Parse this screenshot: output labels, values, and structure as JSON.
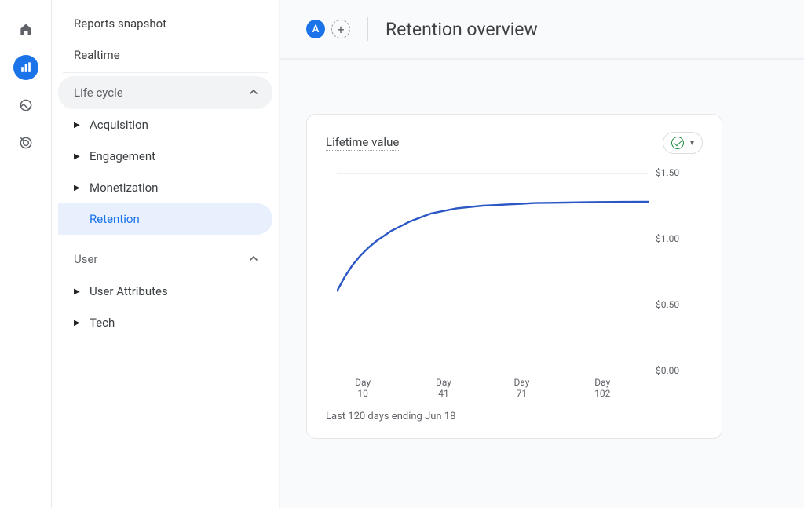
{
  "rail": {
    "items": [
      {
        "name": "home-icon",
        "active": false
      },
      {
        "name": "reports-icon",
        "active": true
      },
      {
        "name": "explore-icon",
        "active": false
      },
      {
        "name": "advertising-icon",
        "active": false
      }
    ]
  },
  "sidebar": {
    "top_links": [
      {
        "label": "Reports snapshot"
      },
      {
        "label": "Realtime"
      }
    ],
    "sections": [
      {
        "label": "Life cycle",
        "expanded": true,
        "shaded": true,
        "items": [
          {
            "label": "Acquisition",
            "expandable": true
          },
          {
            "label": "Engagement",
            "expandable": true
          },
          {
            "label": "Monetization",
            "expandable": true
          },
          {
            "label": "Retention",
            "expandable": false,
            "selected": true
          }
        ]
      },
      {
        "label": "User",
        "expanded": true,
        "shaded": false,
        "items": [
          {
            "label": "User Attributes",
            "expandable": true
          },
          {
            "label": "Tech",
            "expandable": true
          }
        ]
      }
    ]
  },
  "header": {
    "badge": "A",
    "add_label": "+",
    "page_title": "Retention overview"
  },
  "card": {
    "title": "Lifetime value",
    "footer": "Last 120 days ending Jun 18",
    "y_axis_labels": [
      "$0.00",
      "$0.50",
      "$1.00",
      "$1.50"
    ],
    "x_axis_labels": [
      "Day\n10",
      "Day\n41",
      "Day\n71",
      "Day\n102"
    ]
  },
  "chart_data": {
    "type": "line",
    "title": "Lifetime value",
    "xlabel": "",
    "ylabel": "",
    "ylim": [
      0,
      1.5
    ],
    "x": [
      0,
      3,
      6,
      9,
      12,
      15,
      18,
      21,
      24,
      28,
      32,
      36,
      41,
      46,
      51,
      56,
      61,
      66,
      71,
      76,
      82,
      88,
      95,
      102,
      110,
      120
    ],
    "series": [
      {
        "name": "Lifetime value",
        "values": [
          0.6,
          0.71,
          0.8,
          0.87,
          0.93,
          0.98,
          1.02,
          1.06,
          1.09,
          1.13,
          1.16,
          1.19,
          1.21,
          1.23,
          1.24,
          1.25,
          1.255,
          1.26,
          1.265,
          1.27,
          1.272,
          1.274,
          1.276,
          1.278,
          1.279,
          1.28
        ]
      }
    ],
    "x_tick_positions": [
      10,
      41,
      71,
      102
    ]
  }
}
